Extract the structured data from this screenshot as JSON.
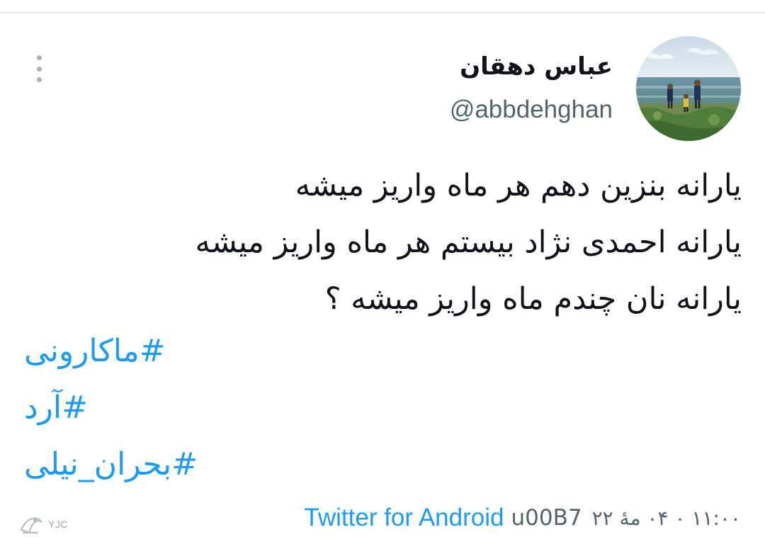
{
  "tweet": {
    "author": {
      "display_name": "عباس دهقان",
      "handle": "@abbdehghan",
      "avatar": "avatar-photo"
    },
    "text_lines": [
      "یارانه بنزین دهم هر ماه واریز میشه",
      "یارانه احمدی نژاد بیستم هر ماه واریز میشه",
      "یارانه نان  چندم ماه واریز میشه ؟"
    ],
    "hashtags": [
      "#ماکارونی",
      "#آرد",
      "#بحران_نیلی"
    ],
    "meta": {
      "timestamp": "۱۱:۰۰ ۰ ۰۴ مۀ ۲۲",
      "separator": "u00B7",
      "source": "Twitter for Android"
    }
  },
  "watermark": {
    "text": "YJC"
  },
  "icons": {
    "more": "more-vertical-icon"
  },
  "colors": {
    "link": "#1d9bf0",
    "text": "#0f1419",
    "secondary": "#536471",
    "divider": "#d9dde1"
  }
}
